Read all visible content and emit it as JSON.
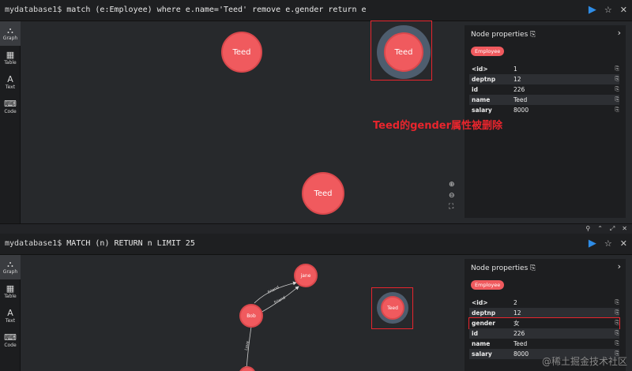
{
  "panel1": {
    "prompt": "mydatabase1$",
    "query": "match (e:Employee) where e.name='Teed' remove e.gender return e",
    "sidebar": [
      {
        "icon": "graph-icon",
        "glyph": "⛬",
        "label": "Graph"
      },
      {
        "icon": "table-icon",
        "glyph": "▦",
        "label": "Table"
      },
      {
        "icon": "text-icon",
        "glyph": "A",
        "label": "Text"
      },
      {
        "icon": "code-icon",
        "glyph": "⌨",
        "label": "Code"
      }
    ],
    "nodes": [
      "Teed",
      "Teed",
      "Teed"
    ],
    "props": {
      "title": "Node properties",
      "badge": "Employee",
      "rows": [
        {
          "key": "<id>",
          "value": "1"
        },
        {
          "key": "deptnp",
          "value": "12"
        },
        {
          "key": "id",
          "value": "226"
        },
        {
          "key": "name",
          "value": "Teed"
        },
        {
          "key": "salary",
          "value": "8000"
        }
      ]
    },
    "annotation": "Teed的gender属性被删除"
  },
  "panel2": {
    "prompt": "mydatabase1$",
    "query": "MATCH (n) RETURN n LIMIT 25",
    "sidebar": [
      {
        "icon": "graph-icon",
        "glyph": "⛬",
        "label": "Graph"
      },
      {
        "icon": "table-icon",
        "glyph": "▦",
        "label": "Table"
      },
      {
        "icon": "text-icon",
        "glyph": "A",
        "label": "Text"
      },
      {
        "icon": "code-icon",
        "glyph": "⌨",
        "label": "Code"
      }
    ],
    "nodes": {
      "bob": "Bob",
      "jane": "jane",
      "teed": "Teed"
    },
    "edges": [
      "Friend",
      "Friend",
      "Love"
    ],
    "props": {
      "title": "Node properties",
      "badge": "Employee",
      "rows": [
        {
          "key": "<id>",
          "value": "2"
        },
        {
          "key": "deptnp",
          "value": "12"
        },
        {
          "key": "gender",
          "value": "女"
        },
        {
          "key": "id",
          "value": "226"
        },
        {
          "key": "name",
          "value": "Teed"
        },
        {
          "key": "salary",
          "value": "8000"
        }
      ]
    }
  },
  "watermark": "@稀土掘金技术社区",
  "colors": {
    "node": "#f05a5e",
    "highlight": "#e8252d",
    "run": "#2e8ce6",
    "ring": "#4e5d6e"
  }
}
